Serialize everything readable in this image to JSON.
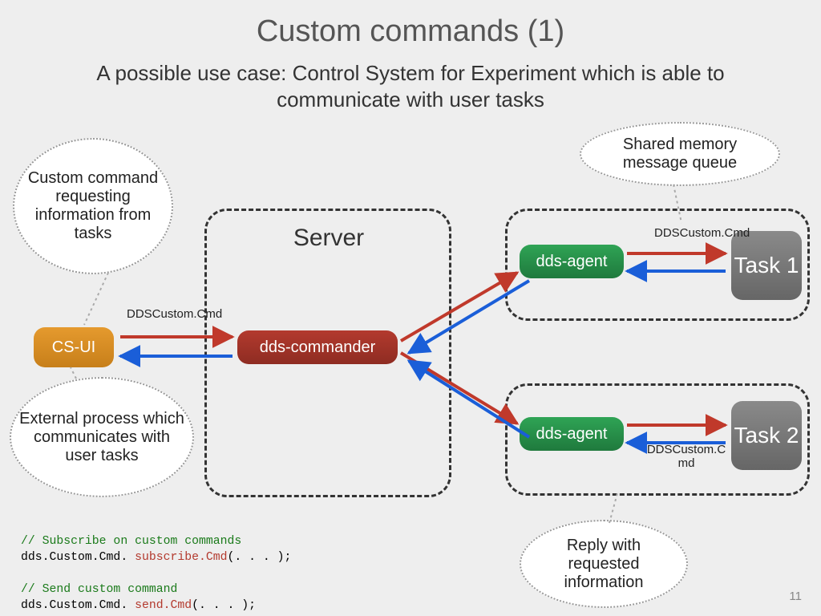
{
  "title": "Custom commands (1)",
  "subtitle": "A possible use case: Control System for Experiment which is able to communicate with user tasks",
  "page_number": "11",
  "callouts": {
    "top_left": "Custom command requesting information from tasks",
    "shared_mem": "Shared memory message queue",
    "ext_proc": "External process which communicates with user tasks",
    "reply": "Reply with requested information"
  },
  "labels": {
    "server": "Server",
    "cs_ui": "CS-UI",
    "dds_commander": "dds-commander",
    "dds_agent": "dds-agent",
    "task1": "Task 1",
    "task2": "Task 2",
    "dds_custom_cmd": "DDSCustom.Cmd",
    "dds_custom_cmd_wrap": "DDSCustom.C md"
  },
  "code": {
    "l1": "// Subscribe on custom commands",
    "l2_pre": "dds.Custom.Cmd. ",
    "l2_fn": "subscribe.Cmd",
    "l2_post": "(. . . );",
    "l3": "// Send custom command",
    "l4_pre": "dds.Custom.Cmd. ",
    "l4_fn": "send.Cmd",
    "l4_post": "(. . . );"
  }
}
